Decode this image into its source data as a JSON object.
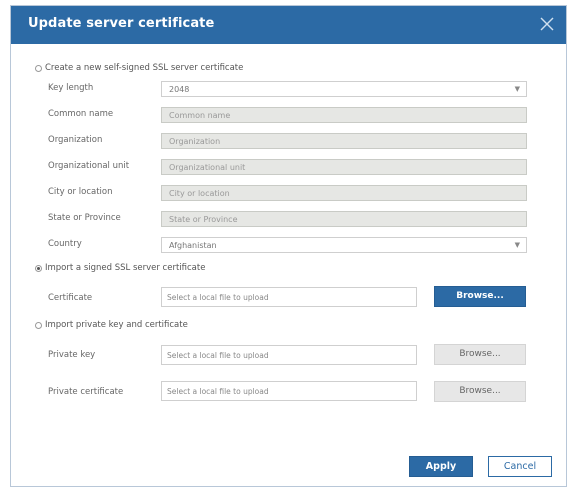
{
  "dialog": {
    "title": "Update server certificate",
    "accent_color": "#2c6aa5"
  },
  "self_signed": {
    "option_label": "Create a new self-signed SSL server certificate",
    "selected": false,
    "fields": {
      "key_length": {
        "label": "Key length",
        "value": "2048"
      },
      "common_name": {
        "label": "Common name",
        "placeholder": "Common name"
      },
      "organization": {
        "label": "Organization",
        "placeholder": "Organization"
      },
      "org_unit": {
        "label": "Organizational unit",
        "placeholder": "Organizational unit"
      },
      "city": {
        "label": "City or location",
        "placeholder": "City or location"
      },
      "state": {
        "label": "State or Province",
        "placeholder": "State or Province"
      },
      "country": {
        "label": "Country",
        "value": "Afghanistan"
      }
    }
  },
  "import_signed": {
    "option_label": "Import a signed SSL server certificate",
    "selected": true,
    "certificate": {
      "label": "Certificate",
      "placeholder": "Select a local file to upload",
      "browse_label": "Browse..."
    }
  },
  "import_key": {
    "option_label": "Import private key and certificate",
    "selected": false,
    "private_key": {
      "label": "Private key",
      "placeholder": "Select a local file to upload",
      "browse_label": "Browse..."
    },
    "private_certificate": {
      "label": "Private certificate",
      "placeholder": "Select a local file to upload",
      "browse_label": "Browse..."
    }
  },
  "footer": {
    "apply_label": "Apply",
    "cancel_label": "Cancel"
  },
  "icons": {
    "close": "close-icon",
    "dropdown": "chevron-down-icon"
  }
}
